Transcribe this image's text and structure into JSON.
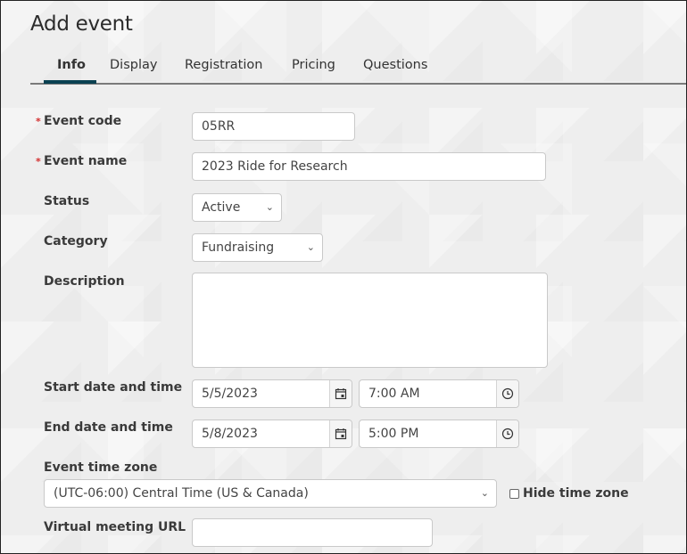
{
  "page": {
    "title": "Add event"
  },
  "tabs": [
    {
      "label": "Info",
      "active": true
    },
    {
      "label": "Display",
      "active": false
    },
    {
      "label": "Registration",
      "active": false
    },
    {
      "label": "Pricing",
      "active": false
    },
    {
      "label": "Questions",
      "active": false
    }
  ],
  "colors": {
    "accent": "#0a4151",
    "required": "#d32f2f"
  },
  "form": {
    "event_code": {
      "label": "Event code",
      "required_marker": "*",
      "value": "05RR"
    },
    "event_name": {
      "label": "Event name",
      "required_marker": "*",
      "value": "2023 Ride for Research"
    },
    "status": {
      "label": "Status",
      "value": "Active"
    },
    "category": {
      "label": "Category",
      "value": "Fundraising"
    },
    "description": {
      "label": "Description",
      "value": ""
    },
    "start": {
      "label": "Start date and time",
      "date": "5/5/2023",
      "time": "7:00 AM"
    },
    "end": {
      "label": "End date and time",
      "date": "5/8/2023",
      "time": "5:00 PM"
    },
    "time_zone": {
      "label": "Event time zone",
      "value": "(UTC-06:00) Central Time (US & Canada)"
    },
    "hide_time_zone": {
      "label": "Hide time zone",
      "checked": false
    },
    "virtual_meeting_url": {
      "label": "Virtual meeting URL",
      "value": ""
    }
  },
  "icons": {
    "chevron": "⌄"
  }
}
